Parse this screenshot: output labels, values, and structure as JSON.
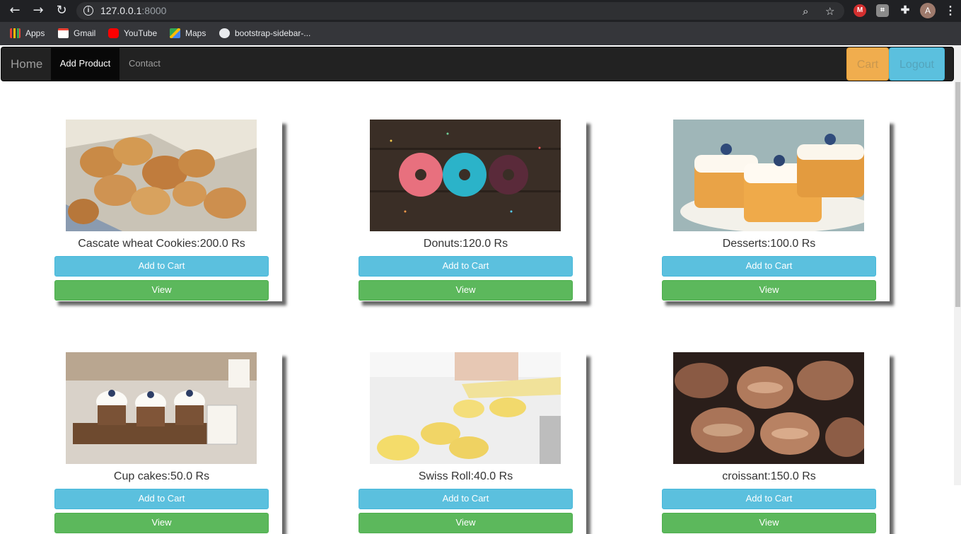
{
  "browser": {
    "url_host": "127.0.0.1",
    "url_port": ":8000",
    "avatar_letter": "A",
    "bookmarks": [
      "Apps",
      "Gmail",
      "YouTube",
      "Maps",
      "bootstrap-sidebar-..."
    ]
  },
  "navbar": {
    "brand": "Home",
    "active_item": "Add Product",
    "link": "Contact",
    "cart_label": "Cart",
    "logout_label": "Logout"
  },
  "products": [
    {
      "title": "Cascate wheat Cookies:200.0 Rs",
      "add_label": "Add to Cart",
      "view_label": "View",
      "image": "cookies"
    },
    {
      "title": "Donuts:120.0 Rs",
      "add_label": "Add to Cart",
      "view_label": "View",
      "image": "donuts"
    },
    {
      "title": "Desserts:100.0 Rs",
      "add_label": "Add to Cart",
      "view_label": "View",
      "image": "desserts"
    },
    {
      "title": "Cup cakes:50.0 Rs",
      "add_label": "Add to Cart",
      "view_label": "View",
      "image": "cupcakes"
    },
    {
      "title": "Swiss Roll:40.0 Rs",
      "add_label": "Add to Cart",
      "view_label": "View",
      "image": "swiss-roll"
    },
    {
      "title": "croissant:150.0 Rs",
      "add_label": "Add to Cart",
      "view_label": "View",
      "image": "croissant"
    }
  ],
  "colors": {
    "info": "#5bc0de",
    "success": "#5cb85c",
    "warning": "#f0ad4e",
    "navbar": "#222222"
  }
}
